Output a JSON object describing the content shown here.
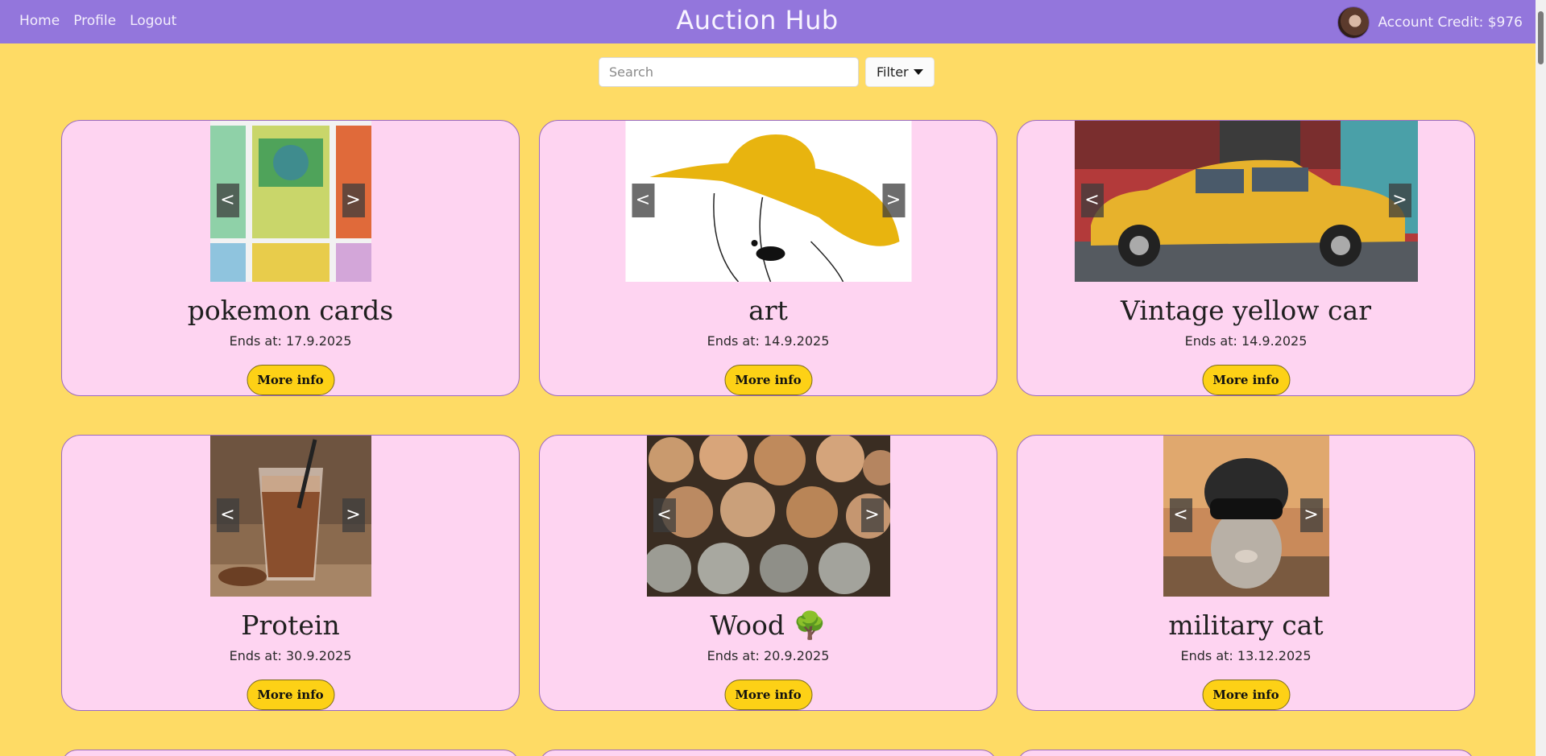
{
  "nav": {
    "links": [
      "Home",
      "Profile",
      "Logout"
    ],
    "brand": "Auction Hub",
    "account_credit": "Account Credit: $976"
  },
  "search": {
    "placeholder": "Search",
    "filter_label": "Filter"
  },
  "card_controls": {
    "prev": "<",
    "next": ">",
    "more_info": "More info"
  },
  "cards": [
    {
      "title": "pokemon cards",
      "ends": "Ends at: 17.9.2025"
    },
    {
      "title": "art",
      "ends": "Ends at: 14.9.2025"
    },
    {
      "title": "Vintage yellow car",
      "ends": "Ends at: 14.9.2025"
    },
    {
      "title": "Protein",
      "ends": "Ends at: 30.9.2025"
    },
    {
      "title": "Wood 🌳",
      "ends": "Ends at: 20.9.2025"
    },
    {
      "title": "military cat",
      "ends": "Ends at: 13.12.2025"
    }
  ],
  "colors": {
    "page_bg": "#fedb65",
    "navbar": "#9376dc",
    "card_bg": "#fed4f1",
    "button": "#fdd116"
  }
}
